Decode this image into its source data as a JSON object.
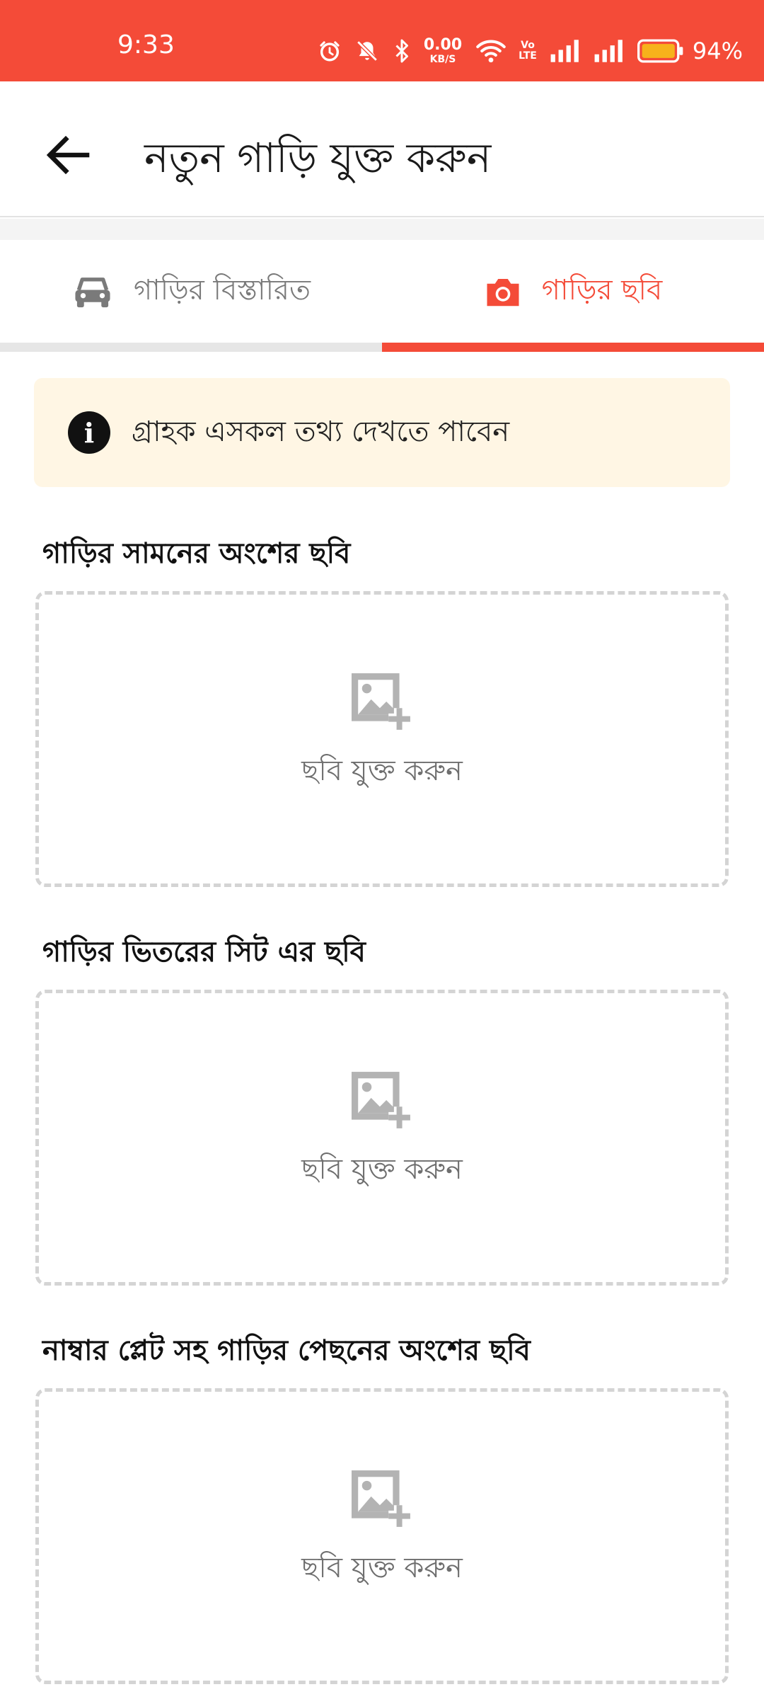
{
  "status_bar": {
    "time": "9:33",
    "net_speed_value": "0.00",
    "net_speed_unit": "KB/S",
    "volte_top": "Vo",
    "volte_bottom": "LTE",
    "battery_percent": "94%",
    "icons": [
      "alarm-icon",
      "mute-icon",
      "bluetooth-icon",
      "wifi-icon",
      "volte-icon",
      "signal-icon",
      "signal-icon",
      "battery-icon"
    ]
  },
  "app_bar": {
    "title": "নতুন গাড়ি যুক্ত করুন",
    "back_icon": "arrow-back-icon"
  },
  "tabs": [
    {
      "label": "গাড়ির বিস্তারিত",
      "icon": "car-icon",
      "active": false
    },
    {
      "label": "গাড়ির ছবি",
      "icon": "camera-icon",
      "active": true
    }
  ],
  "info_banner": {
    "icon": "info-icon",
    "icon_glyph": "i",
    "text": "গ্রাহক এসকল তথ্য দেখতে পাবেন"
  },
  "photo_sections": [
    {
      "title": "গাড়ির সামনের অংশের ছবি",
      "action_label": "ছবি যুক্ত করুন"
    },
    {
      "title": "গাড়ির ভিতরের সিট এর ছবি",
      "action_label": "ছবি যুক্ত করুন"
    },
    {
      "title": "নাম্বার প্লেট সহ গাড়ির পেছনের অংশের ছবি",
      "action_label": "ছবি যুক্ত করুন"
    }
  ],
  "colors": {
    "accent": "#F44B38",
    "banner_bg": "#FFF6E4",
    "inactive_text": "#7a7a7a",
    "upload_border": "#d4d4d4"
  }
}
